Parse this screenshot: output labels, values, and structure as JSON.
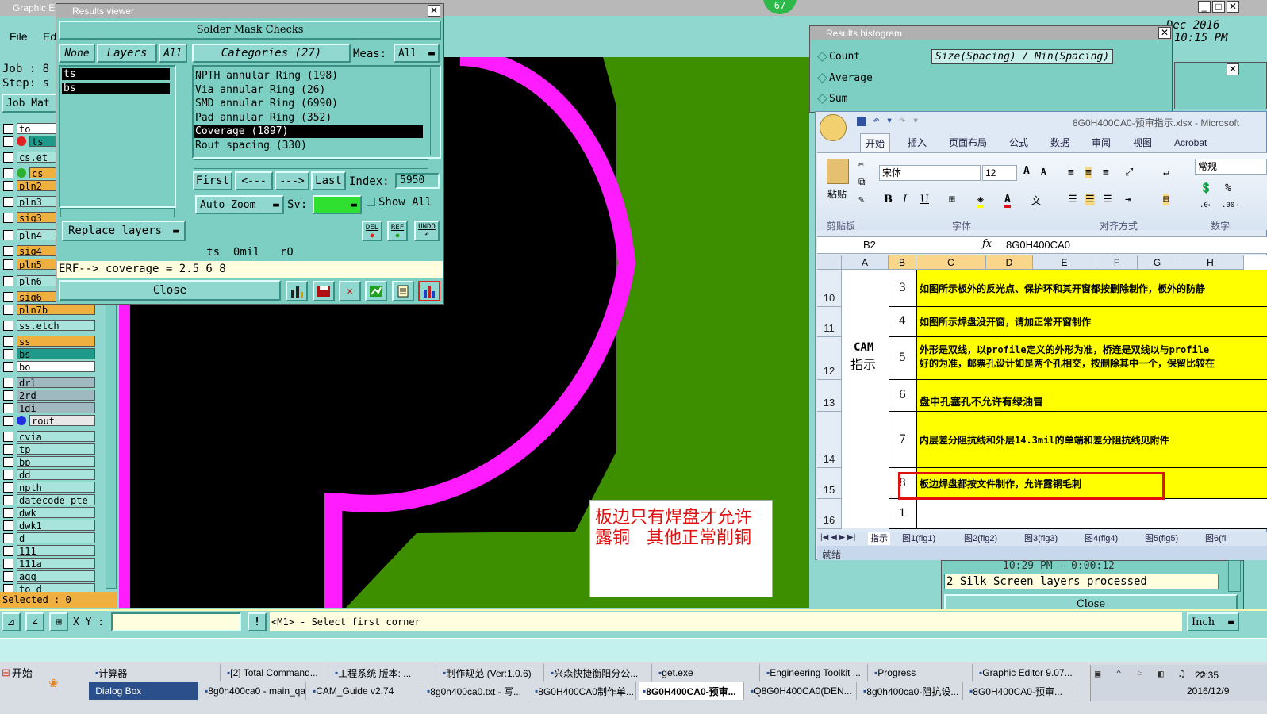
{
  "main_window": {
    "title": "Graphic E",
    "menu_file": "File",
    "menu_edit": "Ed",
    "job_label": "Job : 8",
    "step_label": "Step: s",
    "job_matrix_btn": "Job Mat",
    "date_line1": "Dec 2016",
    "date_line2": "10:15 PM",
    "badge": "67"
  },
  "layers": {
    "items": [
      {
        "name": "to",
        "color": "#ffffff"
      },
      {
        "name": "ts",
        "color": "#1f9a8a",
        "dot": "#e02020"
      },
      {
        "name": "cs.et",
        "color": "#a8e4dc"
      },
      {
        "name": "cs",
        "color": "#f0b040",
        "dot": "#30b030"
      },
      {
        "name": "pln2",
        "color": "#f0b040"
      },
      {
        "name": "pln3",
        "color": "#a8e4dc"
      },
      {
        "name": "sig3",
        "color": "#f0b040"
      },
      {
        "name": "pln4",
        "color": "#a8e4dc"
      },
      {
        "name": "sig4",
        "color": "#f0b040"
      },
      {
        "name": "pln5",
        "color": "#f0b040"
      },
      {
        "name": "pln6",
        "color": "#a8e4dc"
      },
      {
        "name": "sig6",
        "color": "#f0b040"
      },
      {
        "name": "pln7b",
        "color": "#f0b040"
      },
      {
        "name": "ss.etch",
        "color": "#a8e4dc"
      },
      {
        "name": "ss",
        "color": "#f0b040"
      },
      {
        "name": "bs",
        "color": "#1f9a8a"
      },
      {
        "name": "bo",
        "color": "#ffffff"
      },
      {
        "name": "drl",
        "color": "#a0b8c0"
      },
      {
        "name": "2rd",
        "color": "#a0b8c0"
      },
      {
        "name": "1di",
        "color": "#a0b8c0"
      },
      {
        "name": "rout",
        "color": "#e8e8e8",
        "dot": "#2030e0"
      },
      {
        "name": "cvia",
        "color": "#a8e4dc"
      },
      {
        "name": "tp",
        "color": "#a8e4dc"
      },
      {
        "name": "bp",
        "color": "#a8e4dc"
      },
      {
        "name": "dd",
        "color": "#a8e4dc"
      },
      {
        "name": "npth",
        "color": "#a8e4dc"
      },
      {
        "name": "datecode-pte",
        "color": "#a8e4dc"
      },
      {
        "name": "dwk",
        "color": "#a8e4dc"
      },
      {
        "name": "dwk1",
        "color": "#a8e4dc"
      },
      {
        "name": "d",
        "color": "#a8e4dc"
      },
      {
        "name": "111",
        "color": "#a8e4dc"
      },
      {
        "name": "111a",
        "color": "#a8e4dc"
      },
      {
        "name": "aqq",
        "color": "#a8e4dc"
      },
      {
        "name": "to_d",
        "color": "#a8e4dc"
      }
    ],
    "selected_label": "Selected : 0"
  },
  "results_viewer": {
    "title": "Results viewer",
    "header": "Solder Mask Checks",
    "none_btn": "None",
    "layers_btn": "Layers",
    "all_btn": "All",
    "categories_btn": "Categories (27)",
    "meas_label": "Meas:",
    "meas_value": "All",
    "layer_list": [
      "ts",
      "bs"
    ],
    "categories": [
      "NPTH annular Ring (198)",
      "Via annular Ring (26)",
      "SMD annular Ring (6990)",
      "Pad annular Ring (352)",
      "Coverage (1897)",
      "Rout spacing (330)"
    ],
    "selected_category": 4,
    "first_btn": "First",
    "prev_btn": "<---",
    "next_btn": "--->",
    "last_btn": "Last",
    "index_label": "Index:",
    "index_value": "5950",
    "auto_zoom": "Auto Zoom",
    "sv_label": "Sv:",
    "show_all": "Show All",
    "replace_layers": "Replace layers",
    "del_btn": "DEL",
    "ref_btn": "REF",
    "undo_btn": "UNDO",
    "info_line": "ts  0mil   r0",
    "erf_line": "ERF--> coverage = 2.5 6 8",
    "close_btn": "Close"
  },
  "canvas": {
    "annotation_line1": "板边只有焊盘才允许",
    "annotation_line2": "露铜   其他正常削铜"
  },
  "histogram": {
    "title": "Results histogram",
    "radio_count": "Count",
    "radio_average": "Average",
    "radio_sum": "Sum",
    "size_label": "Size(Spacing) / Min(Spacing)"
  },
  "excel": {
    "title": "8G0H400CA0-预审指示.xlsx - Microsoft",
    "tabs": [
      "开始",
      "插入",
      "页面布局",
      "公式",
      "数据",
      "审阅",
      "视图",
      "Acrobat"
    ],
    "font_name": "宋体",
    "font_size": "12",
    "number_format": "常规",
    "group_clipboard": "剪贴板",
    "group_font": "字体",
    "group_align": "对齐方式",
    "group_number": "数字",
    "paste": "粘贴",
    "name_box": "B2",
    "formula": "8G0H400CA0",
    "col_headers": [
      "A",
      "B",
      "C",
      "D",
      "E",
      "F",
      "G",
      "H"
    ],
    "rows": [
      {
        "num": "10",
        "b": "3",
        "text": "如图所示板外的反光点、保护环和其开窗都按删除制作，板外的防静"
      },
      {
        "num": "11",
        "b": "4",
        "text": "如图所示焊盘没开窗，请加正常开窗制作"
      },
      {
        "num": "12",
        "b": "5",
        "text": "外形是双线，以profile定义的外形为准，桥连是双线以与profile",
        "text2": "好的为准，邮票孔设计如是两个孔相交，按删除其中一个，保留比较在"
      },
      {
        "num": "13",
        "b": "6",
        "text": "盘中孔塞孔不允许有绿油冒"
      },
      {
        "num": "14",
        "b": "7",
        "text": "内层差分阻抗线和外层14.3mil的单端和差分阻抗线见附件"
      },
      {
        "num": "15",
        "b": "8",
        "text": "板边焊盘都按文件制作，允许露铜毛刺"
      },
      {
        "num": "16",
        "b": "1",
        "text": ""
      }
    ],
    "cam_label1": "CAM",
    "cam_label2": "指示",
    "sheet_tabs": [
      "指示",
      "图1(fig1)",
      "图2(fig2)",
      "图3(fig3)",
      "图4(fig4)",
      "图5(fig5)",
      "图6(fi"
    ],
    "status": "就绪"
  },
  "progress_window": {
    "time_text": "10:29 PM - 0:00:12",
    "message": "2 Silk Screen layers processed",
    "close_btn": "Close"
  },
  "bottom_bar": {
    "xy_label": "X Y :",
    "prompt": "<M1> - Select first corner",
    "units": "Inch"
  },
  "taskbar": {
    "start": "开始",
    "top_items": [
      "计算器",
      "[2] Total Command...",
      "工程系统  版本: ...",
      "制作规范 (Ver:1.0.6)",
      "兴森快捷衡阳分公...",
      "get.exe",
      "Engineering Toolkit ...",
      "Progress",
      "Graphic Editor 9.07..."
    ],
    "bottom_items": [
      "Dialog Box",
      "8g0h400ca0 - main_qa",
      "CAM_Guide v2.74",
      "8g0h400ca0.txt - 写...",
      "8G0H400CA0制作单...",
      "8G0H400CA0-预审...",
      "Q8G0H400CA0(DEN...",
      "8g0h400ca0-阻抗设...",
      "8G0H400CA0-预审..."
    ],
    "clock_time": "22:35",
    "clock_date": "2016/12/9"
  }
}
